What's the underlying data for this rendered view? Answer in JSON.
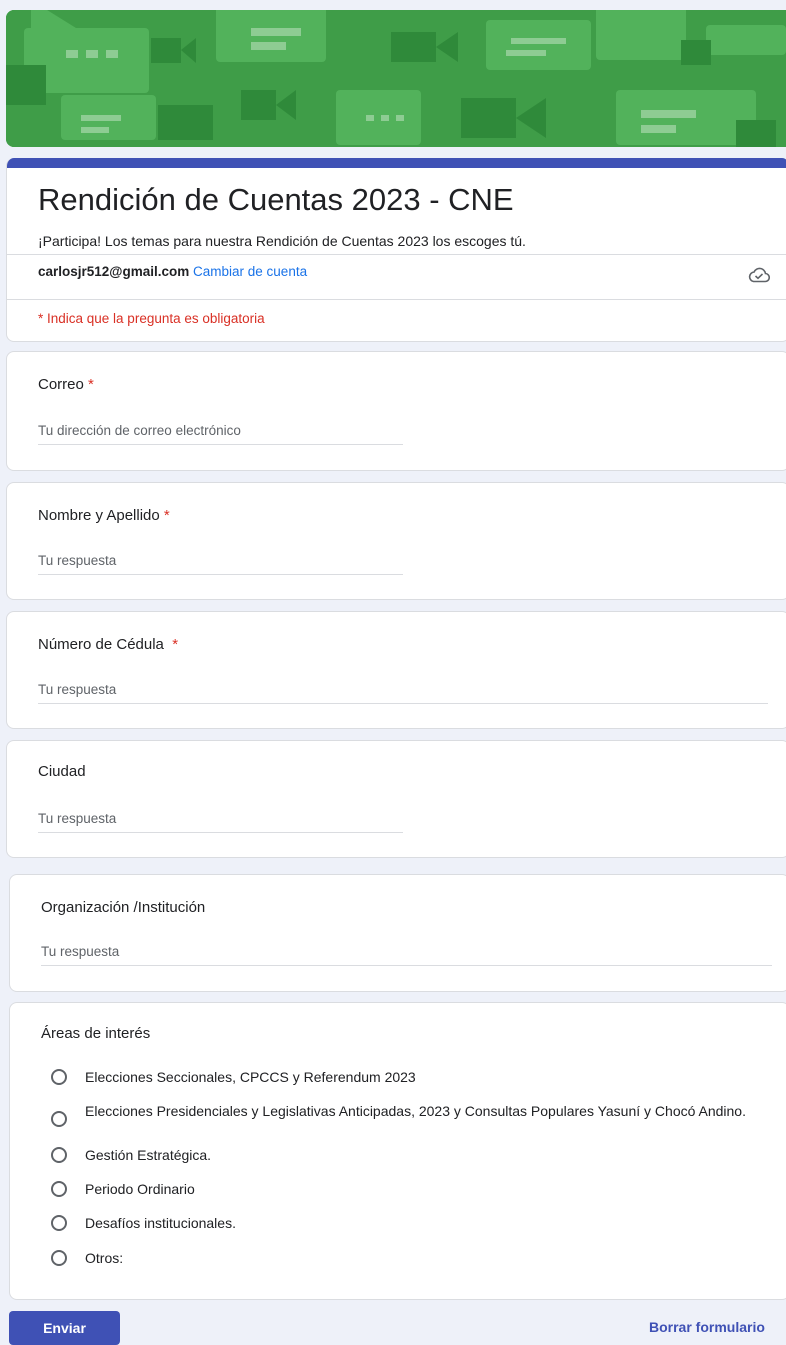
{
  "header": {
    "title": "Rendición de Cuentas 2023 - CNE",
    "description": "¡Participa! Los temas para nuestra Rendición de Cuentas 2023 los escoges tú.",
    "account_email": "carlosjr512@gmail.com",
    "switch_account": "Cambiar de cuenta",
    "required_note": "* Indica que la pregunta es obligatoria"
  },
  "questions": [
    {
      "label": "Correo",
      "required": "*",
      "placeholder": "Tu dirección de correo electrónico"
    },
    {
      "label": "Nombre y Apellido",
      "required": "*",
      "placeholder": "Tu respuesta"
    },
    {
      "label": "Número de Cédula",
      "required": "*",
      "placeholder": "Tu respuesta"
    },
    {
      "label": "Ciudad",
      "placeholder": "Tu respuesta"
    },
    {
      "label": "Organización /Institución",
      "placeholder": "Tu respuesta"
    }
  ],
  "interest": {
    "label": "Áreas de interés",
    "options": [
      "Elecciones Seccionales, CPCCS y Referendum 2023",
      "Elecciones Presidenciales y Legislativas Anticipadas, 2023 y Consultas Populares Yasuní y Chocó Andino.",
      "Gestión Estratégica.",
      "Periodo Ordinario",
      "Desafíos institucionales.",
      "Otros:"
    ]
  },
  "footer": {
    "submit_label": "Enviar",
    "clear_label": "Borrar formulario"
  },
  "colors": {
    "accent": "#3f51b5",
    "banner": "#3f9d48",
    "required": "#d93025",
    "link": "#1a73e8"
  }
}
